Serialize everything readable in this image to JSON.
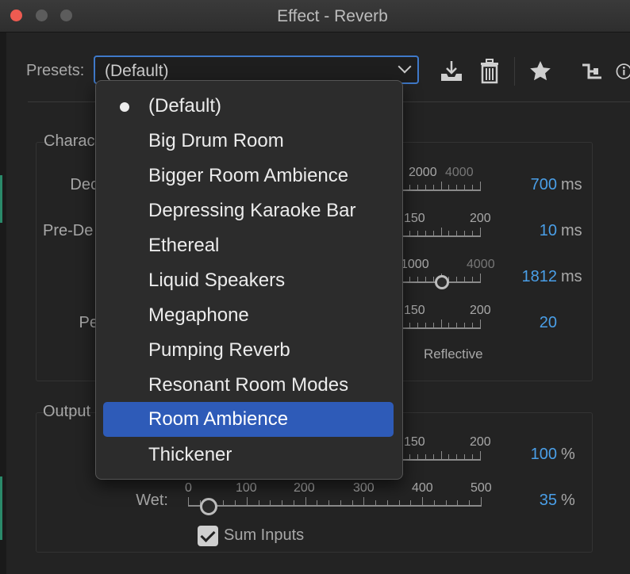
{
  "window": {
    "title": "Effect - Reverb"
  },
  "toolbar": {
    "presets_label": "Presets:",
    "selected_preset": "(Default)",
    "icons": [
      "save-preset-icon",
      "delete-preset-icon",
      "favorite-star-icon",
      "routing-icon",
      "info-icon"
    ]
  },
  "menu": {
    "items": [
      {
        "label": "(Default)",
        "checked": true
      },
      {
        "label": "Big Drum Room"
      },
      {
        "label": "Bigger Room Ambience"
      },
      {
        "label": "Depressing Karaoke Bar"
      },
      {
        "label": "Ethereal"
      },
      {
        "label": "Liquid Speakers"
      },
      {
        "label": "Megaphone"
      },
      {
        "label": "Pumping Reverb"
      },
      {
        "label": "Resonant Room Modes"
      },
      {
        "label": "Room Ambience",
        "highlighted": true
      },
      {
        "label": "Thickener"
      }
    ]
  },
  "characteristics": {
    "title_partial": "Charac",
    "rows": [
      {
        "label_partial": "Dec",
        "ticks": [
          "2000",
          "4000"
        ],
        "value": "700",
        "unit": "ms"
      },
      {
        "label_partial": "Pre-De",
        "ticks": [
          "150",
          "200"
        ],
        "value": "10",
        "unit": "ms"
      },
      {
        "ticks": [
          "1000",
          "4000"
        ],
        "value": "1812",
        "unit": "ms"
      },
      {
        "label_partial": "Pe",
        "ticks": [
          "150",
          "200"
        ],
        "value": "20",
        "extra_label": "Reflective"
      }
    ]
  },
  "output": {
    "title_partial": "Output",
    "dry": {
      "ticks": [
        "150",
        "200"
      ],
      "value": "100",
      "unit": "%"
    },
    "wet": {
      "label": "Wet:",
      "ticks": [
        "0",
        "100",
        "200",
        "300",
        "400",
        "500"
      ],
      "value": "35",
      "unit": "%"
    },
    "sum_inputs": {
      "label": "Sum Inputs",
      "checked": true
    }
  },
  "colors": {
    "accent": "#4a9fe8",
    "selection": "#2e5bb8",
    "focus_border": "#3f79c9"
  }
}
